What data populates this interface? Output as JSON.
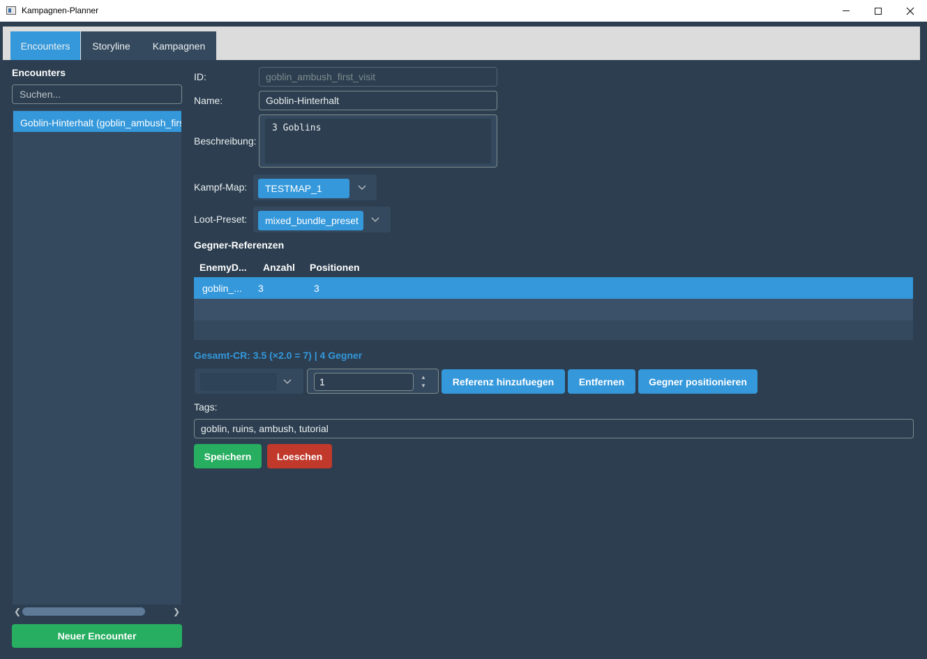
{
  "window": {
    "title": "Kampagnen-Planner"
  },
  "tabs": [
    "Encounters",
    "Storyline",
    "Kampagnen"
  ],
  "sidebar": {
    "title": "Encounters",
    "search_placeholder": "Suchen...",
    "items": [
      "Goblin-Hinterhalt (goblin_ambush_first_visit)"
    ],
    "new_button": "Neuer Encounter"
  },
  "form": {
    "id_label": "ID:",
    "id_value": "goblin_ambush_first_visit",
    "name_label": "Name:",
    "name_value": "Goblin-Hinterhalt",
    "description_label": "Beschreibung:",
    "description_value": "3 Goblins",
    "map_label": "Kampf-Map:",
    "map_value": "TESTMAP_1",
    "loot_label": "Loot-Preset:",
    "loot_value": "mixed_bundle_preset",
    "enemies_title": "Gegner-Referenzen",
    "table": {
      "columns": [
        "EnemyD...",
        "Anzahl",
        "Positionen"
      ],
      "rows": [
        {
          "enemy": "goblin_...",
          "count": "3",
          "positions": "3"
        }
      ]
    },
    "cr_summary": "Gesamt-CR: 3.5 (×2.0 = 7) | 4 Gegner",
    "quantity_value": "1",
    "add_ref_button": "Referenz hinzufuegen",
    "remove_button": "Entfernen",
    "position_button": "Gegner positionieren",
    "tags_label": "Tags:",
    "tags_value": "goblin, ruins, ambush, tutorial",
    "save_button": "Speichern",
    "delete_button": "Loeschen"
  },
  "colors": {
    "background": "#2c3e50",
    "accent": "#3498db",
    "success": "#27ae60",
    "danger": "#c0392b"
  }
}
